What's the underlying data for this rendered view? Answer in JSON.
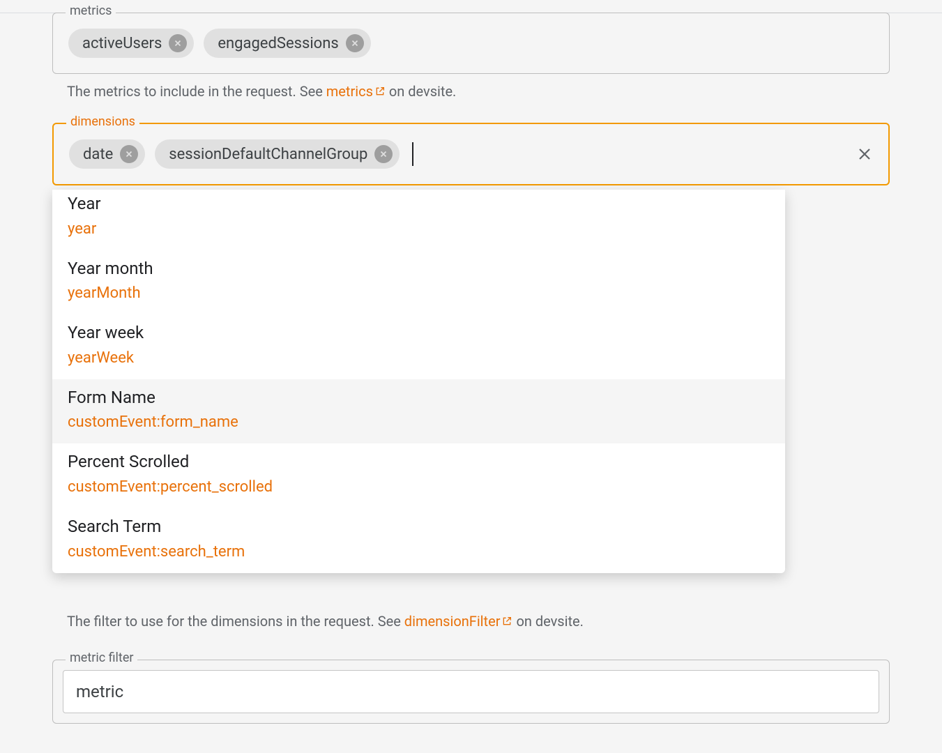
{
  "colors": {
    "accent": "#e8710a",
    "chipBg": "#e0e0e0",
    "chipX": "#9e9e9e",
    "text": "#202124",
    "muted": "#5f6368",
    "focusBorder": "#f29900"
  },
  "metrics": {
    "legend": "metrics",
    "chips": [
      "activeUsers",
      "engagedSessions"
    ],
    "helper_prefix": "The metrics to include in the request. See ",
    "helper_link": "metrics",
    "helper_suffix": " on devsite."
  },
  "dimensions": {
    "legend": "dimensions",
    "chips": [
      "date",
      "sessionDefaultChannelGroup"
    ],
    "helper_prefix": "The filter to use for the dimensions in the request. See ",
    "helper_link": "dimensionFilter",
    "helper_suffix": " on devsite."
  },
  "dropdown": {
    "options": [
      {
        "title": "Year",
        "sub": "year",
        "highlight": false,
        "first": true
      },
      {
        "title": "Year month",
        "sub": "yearMonth",
        "highlight": false
      },
      {
        "title": "Year week",
        "sub": "yearWeek",
        "highlight": false
      },
      {
        "title": "Form Name",
        "sub": "customEvent:form_name",
        "highlight": true
      },
      {
        "title": "Percent Scrolled",
        "sub": "customEvent:percent_scrolled",
        "highlight": false
      },
      {
        "title": "Search Term",
        "sub": "customEvent:search_term",
        "highlight": false
      }
    ]
  },
  "metricFilter": {
    "legend": "metric filter",
    "inner": "metric"
  }
}
